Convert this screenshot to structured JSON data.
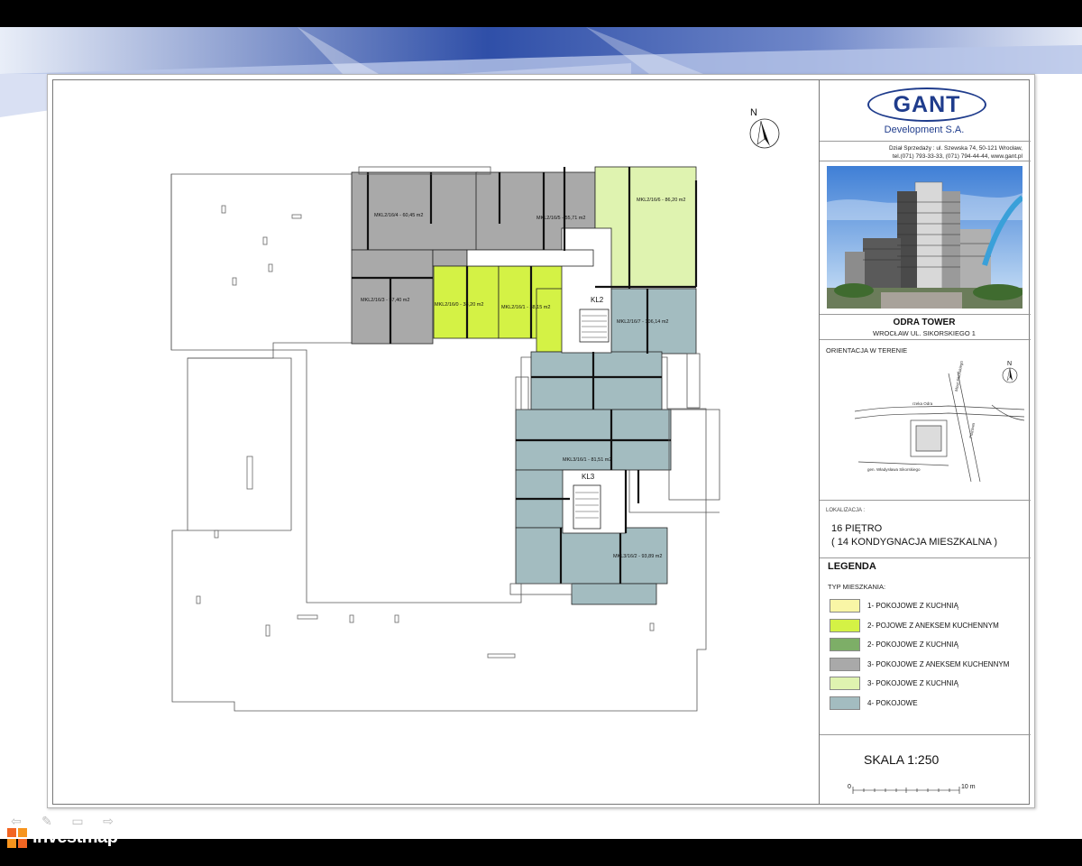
{
  "company": {
    "logo": "GANT",
    "subtitle": "Development S.A.",
    "contact_line1": "Dział Sprzedaży : ul. Szewska 74, 50-121 Wrocław,",
    "contact_line2": "tel.(071) 793-33-33, (071) 794-44-44, www.gant.pl"
  },
  "project": {
    "name": "ODRA TOWER",
    "address": "WROCŁAW UL. SIKORSKIEGO 1"
  },
  "orientation": {
    "label": "ORIENTACJA W TERENIE",
    "north": "N",
    "street_odra": "rzeka Odra",
    "street_most": "Most Sikorskiego",
    "street_sikorskiego": "gen. Władysława Sikorskiego",
    "street_plac": "Plażowa"
  },
  "location": {
    "label": "LOKALIZACJA :",
    "floor": "16 PIĘTRO",
    "floor_detail": "( 14 KONDYGNACJA MIESZKALNA )"
  },
  "legend": {
    "title": "LEGENDA",
    "type_label": "TYP MIESZKANIA:",
    "items": [
      {
        "label": "1- POKOJOWE Z KUCHNIĄ",
        "color": "#f9f6a6"
      },
      {
        "label": "2- POJOWE Z ANEKSEM KUCHENNYM",
        "color": "#d4f245"
      },
      {
        "label": "2- POKOJOWE Z KUCHNIĄ",
        "color": "#7dae67"
      },
      {
        "label": "3- POKOJOWE Z ANEKSEM KUCHENNYM",
        "color": "#a9a9a9"
      },
      {
        "label": "3- POKOJOWE Z KUCHNIĄ",
        "color": "#dff3b0"
      },
      {
        "label": "4- POKOJOWE",
        "color": "#a3bcc0"
      }
    ]
  },
  "scale": {
    "label": "SKALA 1:250",
    "zero": "0",
    "ten": "10 m"
  },
  "plan": {
    "north": "N",
    "stair_kl2": "KL2",
    "stair_kl3": "KL3",
    "units": [
      {
        "label": "MKL2/16/4 - 60,45 m2"
      },
      {
        "label": "MKL2/16/5 - 55,71 m2"
      },
      {
        "label": "MKL2/16/6 - 86,20 m2"
      },
      {
        "label": "MKL2/16/3 - 57,40 m2"
      },
      {
        "label": "MKL2/16/0 - 38,20 m2"
      },
      {
        "label": "MKL2/16/1 - 38,15 m2"
      },
      {
        "label": "MKL2/16/7 - 106,14 m2"
      },
      {
        "label": "MKL3/16/1 - 81,51 m2"
      },
      {
        "label": "MKL3/16/2 - 93,89 m2"
      }
    ]
  },
  "colors": {
    "gray": "#a9a9a9",
    "lime": "#d4f245",
    "pale_green": "#dff3b0",
    "teal": "#a3bcc0",
    "brand_blue": "#1f3c8c"
  },
  "watermark": {
    "text": "investmap"
  },
  "controls": [
    "prev-icon",
    "pen-icon",
    "menu-icon",
    "next-icon"
  ]
}
